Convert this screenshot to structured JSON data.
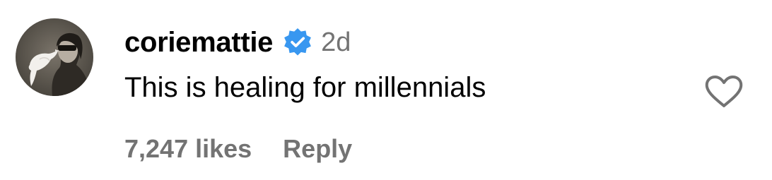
{
  "comment": {
    "username": "coriemattie",
    "verified": true,
    "time": "2d",
    "text": "This is healing for millennials",
    "likes": "7,247 likes",
    "reply_label": "Reply"
  },
  "icons": {
    "avatar": "profile-photo",
    "verified": "verified-badge-icon",
    "like": "heart-outline-icon"
  },
  "colors": {
    "text": "#000000",
    "secondary_text": "#737373",
    "verified_badge": "#3897f0",
    "heart_outline": "#737373"
  }
}
